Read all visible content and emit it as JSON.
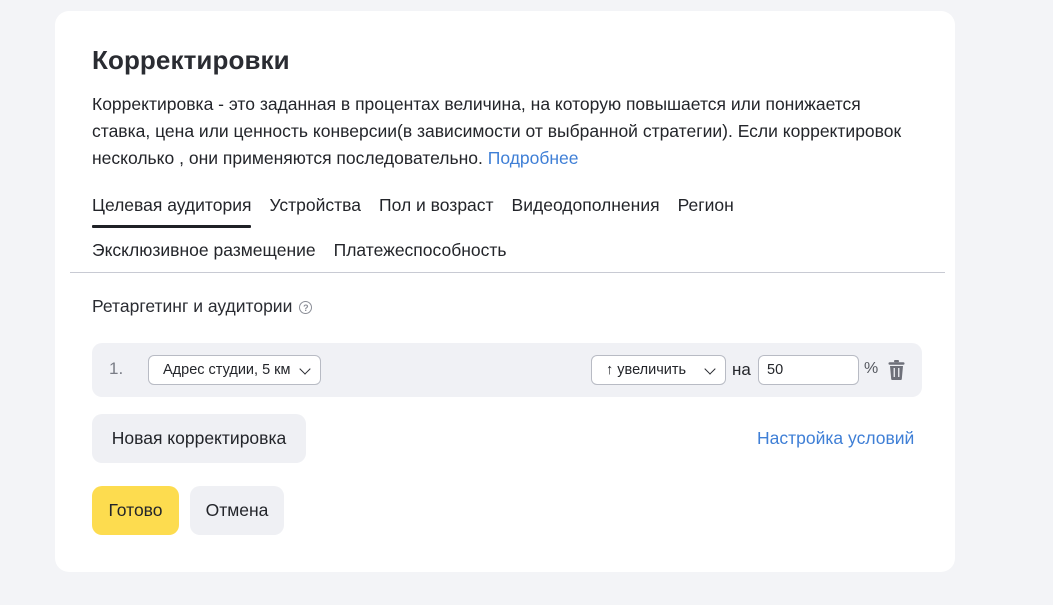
{
  "panel": {
    "title": "Корректировки",
    "description": "Корректировка - это заданная в процентах величина, на которую повышается или понижается ставка, цена или ценность конверсии(в зависимости от выбранной стратегии). Если корректировок несколько , они применяются последовательно.",
    "more_link": "Подробнее"
  },
  "tabs": [
    {
      "label": "Целевая аудитория",
      "active": true
    },
    {
      "label": "Устройства",
      "active": false
    },
    {
      "label": "Пол и возраст",
      "active": false
    },
    {
      "label": "Видеодополнения",
      "active": false
    },
    {
      "label": "Регион",
      "active": false
    },
    {
      "label": "Эксклюзивное размещение",
      "active": false
    },
    {
      "label": "Платежеспособность",
      "active": false
    }
  ],
  "section": {
    "title": "Ретаргетинг и аудитории",
    "help_icon": "question-circle-icon"
  },
  "rules": [
    {
      "number": "1.",
      "audience": "Адрес студии, 5 км",
      "direction": "↑ увеличить",
      "on_label": "на",
      "value": "50",
      "unit": "%"
    }
  ],
  "actions": {
    "new_rule": "Новая корректировка",
    "settings_link": "Настройка условий",
    "done": "Готово",
    "cancel": "Отмена"
  },
  "colors": {
    "accent_yellow": "#fddc4f",
    "link_blue": "#3f7fd6",
    "page_bg": "#f3f4f7"
  }
}
